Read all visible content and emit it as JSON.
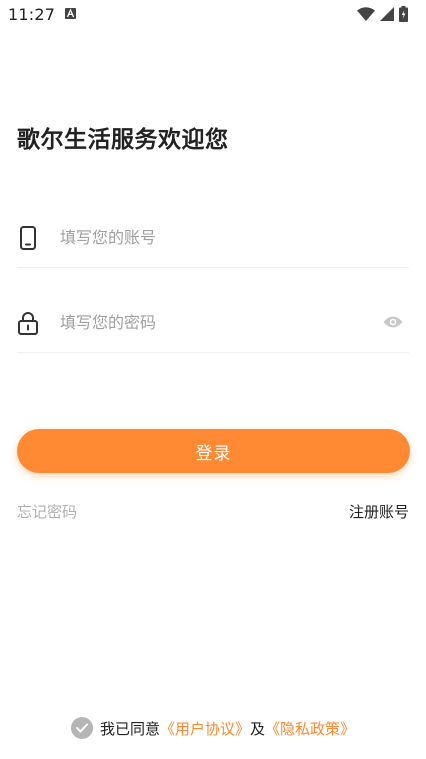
{
  "status_bar": {
    "time": "11:27"
  },
  "title": "歌尔生活服务欢迎您",
  "account_field": {
    "placeholder": "填写您的账号",
    "value": ""
  },
  "password_field": {
    "placeholder": "填写您的密码",
    "value": ""
  },
  "login_button": "登录",
  "forgot_password": "忘记密码",
  "register": "注册账号",
  "agreement": {
    "prefix": "我已同意",
    "user_agreement": "《用户协议》",
    "conjunction": "及",
    "privacy_policy": "《隐私政策》"
  },
  "colors": {
    "accent": "#ff8a33",
    "muted_text": "#b0b0b0"
  },
  "icons": {
    "account": "phone-icon",
    "password": "lock-icon",
    "toggle_visibility": "eye-icon",
    "agree": "check-circle-icon"
  }
}
